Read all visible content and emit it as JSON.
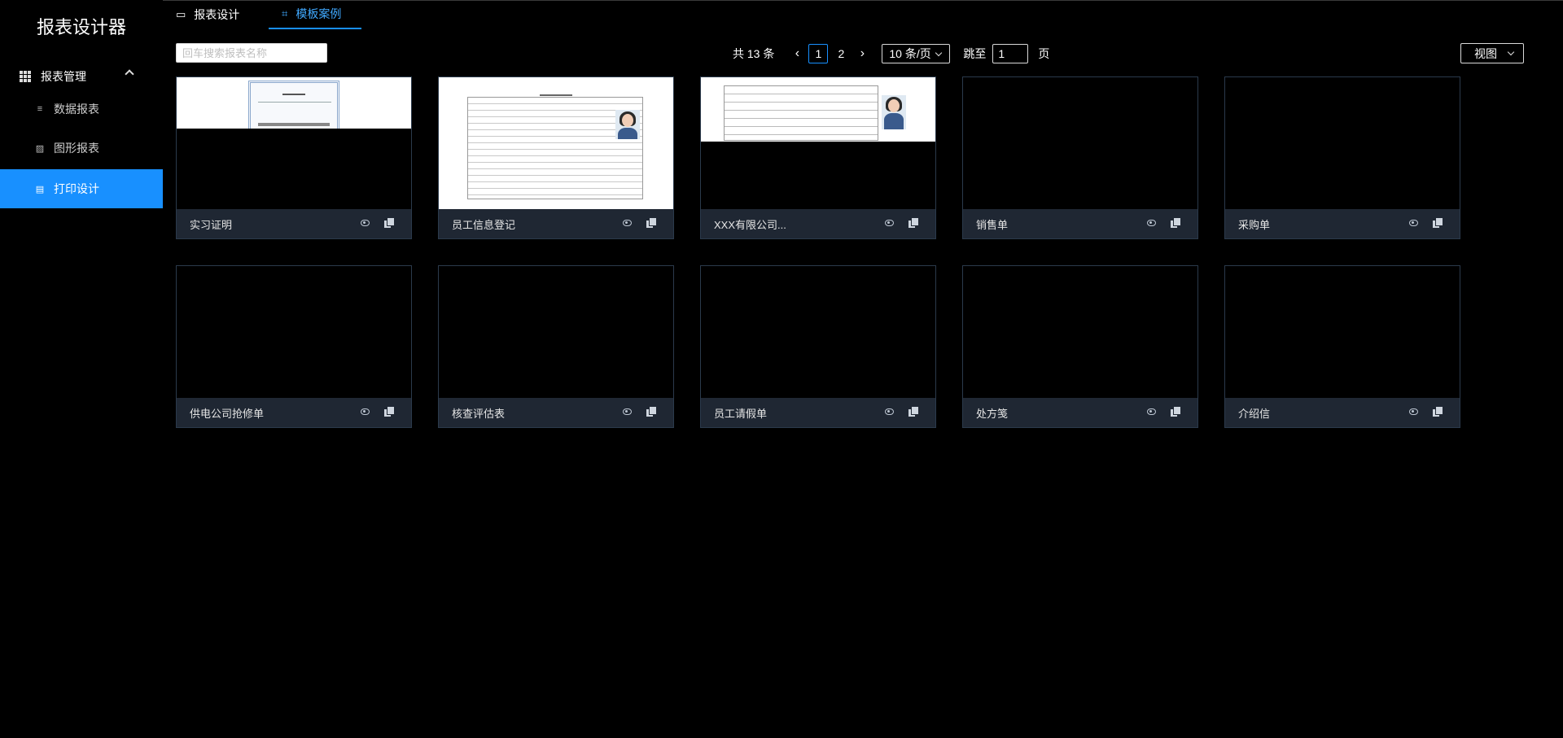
{
  "app": {
    "title": "报表设计器"
  },
  "sidebar": {
    "group": {
      "label": "报表管理",
      "icon": "grid-icon",
      "expand_icon": "chevron-up-icon"
    },
    "items": [
      {
        "label": "数据报表",
        "icon": "list-icon",
        "active": false
      },
      {
        "label": "图形报表",
        "icon": "image-icon",
        "active": false
      },
      {
        "label": "打印设计",
        "icon": "printer-icon",
        "active": true
      }
    ]
  },
  "tabs": [
    {
      "label": "报表设计",
      "icon": "monitor-icon",
      "active": false
    },
    {
      "label": "模板案例",
      "icon": "template-icon",
      "active": true
    }
  ],
  "search": {
    "placeholder": "回车搜索报表名称",
    "value": ""
  },
  "pagination": {
    "total_text": "共 13 条",
    "pages": [
      "1",
      "2"
    ],
    "current": "1",
    "page_size": "10 条/页",
    "jump_label": "跳至",
    "jump_value": "1",
    "page_word": "页"
  },
  "view_button": {
    "label": "视图"
  },
  "cards": [
    {
      "name": "实习证明",
      "thumb": "certificate"
    },
    {
      "name": "员工信息登记",
      "thumb": "employee-form"
    },
    {
      "name": "XXX有限公司...",
      "thumb": "company-form"
    },
    {
      "name": "销售单",
      "thumb": "none"
    },
    {
      "name": "采购单",
      "thumb": "none"
    },
    {
      "name": "供电公司抢修单",
      "thumb": "none"
    },
    {
      "name": "核查评估表",
      "thumb": "none"
    },
    {
      "name": "员工请假单",
      "thumb": "none"
    },
    {
      "name": "处方笺",
      "thumb": "none"
    },
    {
      "name": "介绍信",
      "thumb": "none"
    }
  ],
  "colors": {
    "accent": "#1890ff",
    "card_footer": "#1f2733",
    "card_border": "#2b3a4c",
    "background": "#000000"
  }
}
